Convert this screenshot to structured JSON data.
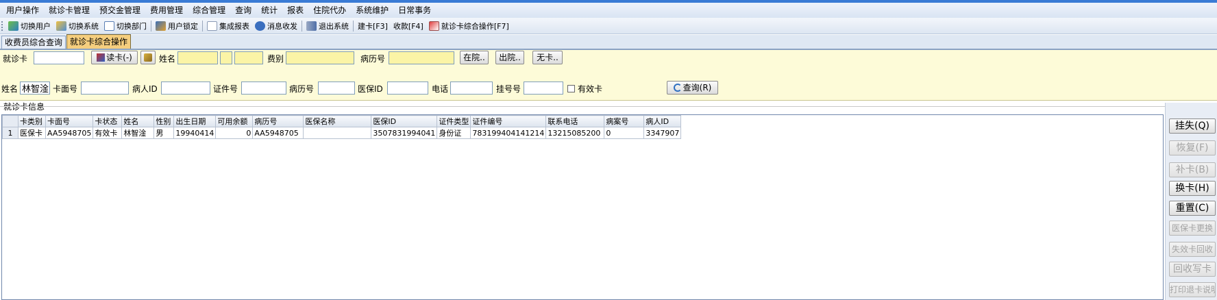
{
  "menu": [
    "用户操作",
    "就诊卡管理",
    "预交金管理",
    "费用管理",
    "综合管理",
    "查询",
    "统计",
    "报表",
    "住院代办",
    "系统维护",
    "日常事务"
  ],
  "toolbar": {
    "switch_user": "切换用户",
    "switch_system": "切换系统",
    "switch_dept": "切换部门",
    "user_lock": "用户锁定",
    "integrated_report": "集成报表",
    "message": "消息收发",
    "exit_system": "退出系统",
    "create_card": "建卡[F3]",
    "collect": "收款[F4]",
    "card_ops": "就诊卡综合操作[F7]"
  },
  "tabs": [
    "收费员综合查询",
    "就诊卡综合操作"
  ],
  "top_form": {
    "card_label": "就诊卡",
    "card_value": "",
    "read_card_button": "读卡(-)",
    "name_label": "姓名",
    "name_value": "",
    "fee_type_label": "费别",
    "fee_type_value": "",
    "record_no_label": "病历号",
    "record_no_value": "",
    "in_hospital_button": "在院..",
    "discharged_button": "出院..",
    "no_card_button": "无卡.."
  },
  "search_form": {
    "name_label": "姓名",
    "name_value": "林智淦",
    "card_face_label": "卡面号",
    "patient_id_label": "病人ID",
    "cert_no_label": "证件号",
    "record_no_label": "病历号",
    "insurance_id_label": "医保ID",
    "phone_label": "电话",
    "reg_no_label": "挂号号",
    "valid_card_label": "有效卡",
    "query_button": "查询(R)"
  },
  "section_title": "就诊卡信息",
  "table": {
    "headers": [
      "卡类别",
      "卡面号",
      "卡状态",
      "姓名",
      "性别",
      "出生日期",
      "可用余额",
      "病历号",
      "医保名称",
      "医保ID",
      "证件类型",
      "证件编号",
      "联系电话",
      "病案号",
      "病人ID"
    ],
    "rows": [
      [
        "1",
        "医保卡",
        "AA5948705",
        "有效卡",
        "林智淦",
        "男",
        "19940414",
        "0",
        "AA5948705",
        "",
        "3507831994041",
        "身份证",
        "783199404141214",
        "13215085200",
        "0",
        "3347907"
      ]
    ]
  },
  "side_buttons": [
    {
      "label": "挂失(Q)",
      "enabled": true
    },
    {
      "label": "恢复(F)",
      "enabled": false
    },
    {
      "label": "补卡(B)",
      "enabled": false
    },
    {
      "label": "换卡(H)",
      "enabled": true
    },
    {
      "label": "重置(C)",
      "enabled": true
    },
    {
      "label": "医保卡更换",
      "enabled": false
    },
    {
      "label": "失效卡回收",
      "enabled": false
    },
    {
      "label": "回收写卡",
      "enabled": false
    },
    {
      "label": "打印退卡说明",
      "enabled": false
    }
  ],
  "colors": {
    "accent": "#3a7bd5",
    "form_bg": "#fdfbd8",
    "highlight_input": "#fbf4a6",
    "active_tab": "#f5ce7e"
  }
}
